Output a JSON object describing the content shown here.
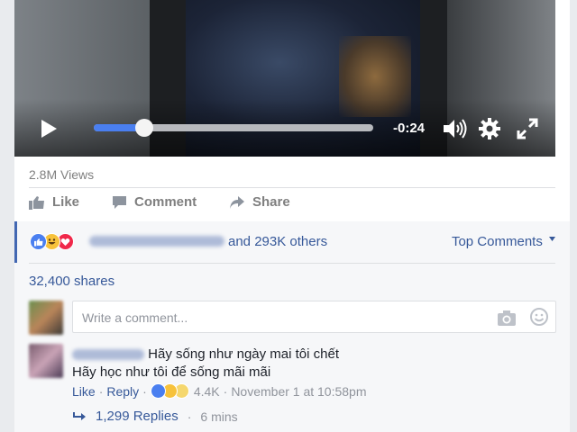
{
  "video": {
    "time_remaining": "-0:24",
    "progress_fraction": 0.18
  },
  "stats": {
    "views": "2.8M Views"
  },
  "actions": {
    "like": "Like",
    "comment": "Comment",
    "share": "Share"
  },
  "reactions": {
    "others_text": "and 293K others",
    "sort_label": "Top Comments",
    "shares": "32,400 shares",
    "icons": [
      "like-icon",
      "haha-icon",
      "love-icon"
    ]
  },
  "comment_box": {
    "placeholder": "Write a comment..."
  },
  "comment": {
    "line1": "Hãy sống như ngày mai tôi chết",
    "line2": "Hãy học như tôi để sống mãi mãi",
    "like": "Like",
    "reply": "Reply",
    "reaction_count": "4.4K",
    "timestamp": "November 1 at 10:58pm",
    "sep": "·",
    "replies_text": "1,299 Replies",
    "replies_time": "6 mins"
  },
  "colors": {
    "accent": "#365899",
    "progress": "#4a7ff0",
    "border_accent": "#4267b2"
  }
}
